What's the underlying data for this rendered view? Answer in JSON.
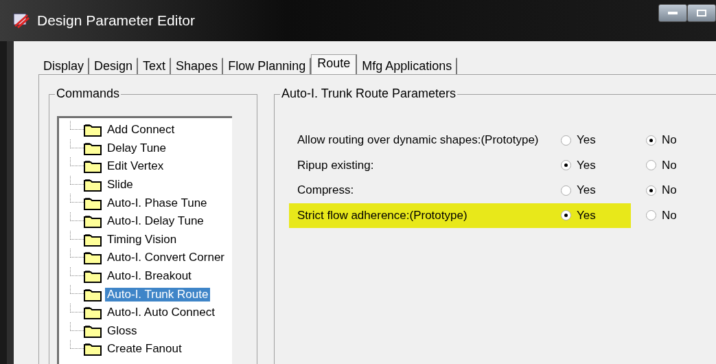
{
  "window": {
    "title": "Design Parameter Editor"
  },
  "tabs": [
    {
      "label": "Display",
      "selected": false
    },
    {
      "label": "Design",
      "selected": false
    },
    {
      "label": "Text",
      "selected": false
    },
    {
      "label": "Shapes",
      "selected": false
    },
    {
      "label": "Flow Planning",
      "selected": false
    },
    {
      "label": "Route",
      "selected": true
    },
    {
      "label": "Mfg Applications",
      "selected": false
    }
  ],
  "commands": {
    "title": "Commands",
    "items": [
      {
        "label": "Add Connect",
        "selected": false
      },
      {
        "label": "Delay Tune",
        "selected": false
      },
      {
        "label": "Edit Vertex",
        "selected": false
      },
      {
        "label": "Slide",
        "selected": false
      },
      {
        "label": "Auto-I. Phase Tune",
        "selected": false
      },
      {
        "label": "Auto-I. Delay Tune",
        "selected": false
      },
      {
        "label": "Timing Vision",
        "selected": false
      },
      {
        "label": "Auto-I. Convert Corner",
        "selected": false
      },
      {
        "label": "Auto-I. Breakout",
        "selected": false
      },
      {
        "label": "Auto-I. Trunk Route",
        "selected": true
      },
      {
        "label": "Auto-I. Auto Connect",
        "selected": false
      },
      {
        "label": "Gloss",
        "selected": false
      },
      {
        "label": "Create Fanout",
        "selected": false
      }
    ]
  },
  "parameters": {
    "title": "Auto-I. Trunk Route Parameters",
    "rows": [
      {
        "label": "Allow routing over dynamic shapes:(Prototype)",
        "highlighted": false,
        "options": [
          {
            "label": "Yes",
            "selected": false
          },
          {
            "label": "No",
            "selected": true
          }
        ]
      },
      {
        "label": "Ripup existing:",
        "highlighted": false,
        "options": [
          {
            "label": "Yes",
            "selected": true
          },
          {
            "label": "No",
            "selected": false
          }
        ]
      },
      {
        "label": "Compress:",
        "highlighted": false,
        "options": [
          {
            "label": "Yes",
            "selected": false
          },
          {
            "label": "No",
            "selected": true
          }
        ]
      },
      {
        "label": "Strict flow adherence:(Prototype)",
        "highlighted": true,
        "options": [
          {
            "label": "Yes",
            "selected": true
          },
          {
            "label": "No",
            "selected": false
          }
        ]
      }
    ]
  }
}
